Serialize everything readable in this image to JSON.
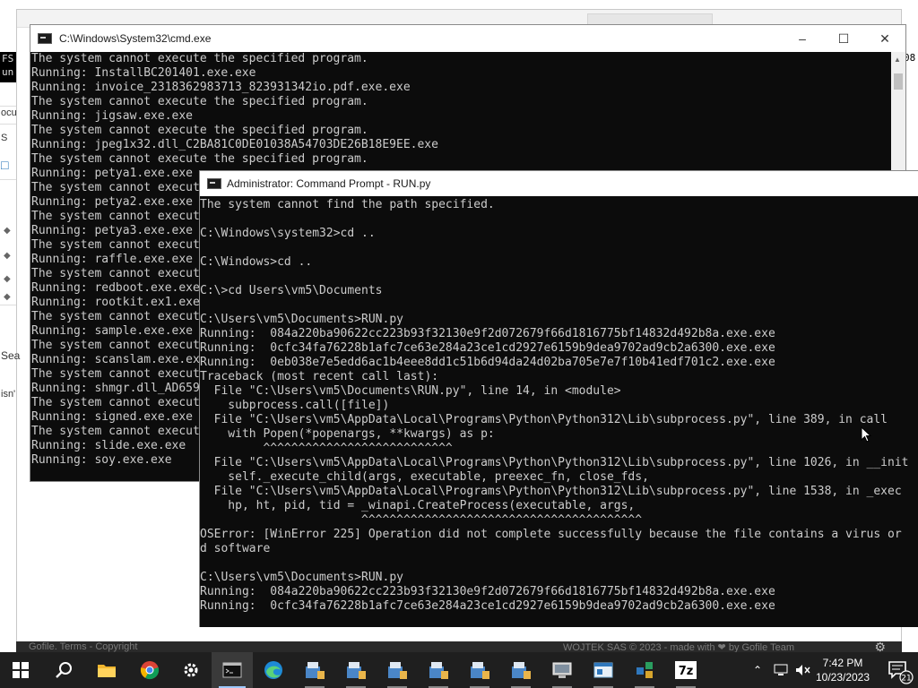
{
  "background": {
    "footer_left": "Gofile. Terms - Copyright",
    "footer_right": "WOJTEK SAS © 2023 - made with ❤ by Gofile Team",
    "left_fragments": [
      "ocu",
      "S",
      "Sea",
      "isn'"
    ],
    "top_left_fragment": [
      "FS",
      "un"
    ],
    "right_fragment": "08"
  },
  "cmd_window": {
    "title": "C:\\Windows\\System32\\cmd.exe",
    "lines": [
      "The system cannot execute the specified program.",
      "Running: InstallBC201401.exe.exe",
      "Running: invoice_2318362983713_823931342io.pdf.exe.exe",
      "The system cannot execute the specified program.",
      "Running: jigsaw.exe.exe",
      "The system cannot execute the specified program.",
      "Running: jpeg1x32.dll_C2BA81C0DE01038A54703DE26B18E9EE.exe",
      "The system cannot execute the specified program.",
      "Running: petya1.exe.exe",
      "The system cannot execut",
      "Running: petya2.exe.exe",
      "The system cannot execut",
      "Running: petya3.exe.exe",
      "The system cannot execut",
      "Running: raffle.exe.exe",
      "The system cannot execut",
      "Running: redboot.exe.exe",
      "Running: rootkit.ex1.exe",
      "The system cannot execut",
      "Running: sample.exe.exe",
      "The system cannot execut",
      "Running: scanslam.exe.ex",
      "The system cannot execut",
      "Running: shmgr.dll_AD659",
      "The system cannot execut",
      "Running: signed.exe.exe",
      "The system cannot execut",
      "Running: slide.exe.exe",
      "Running: soy.exe.exe"
    ]
  },
  "admin_window": {
    "title": "Administrator: Command Prompt - RUN.py",
    "lines": [
      "The system cannot find the path specified.",
      "",
      "C:\\Windows\\system32>cd ..",
      "",
      "C:\\Windows>cd ..",
      "",
      "C:\\>cd Users\\vm5\\Documents",
      "",
      "C:\\Users\\vm5\\Documents>RUN.py",
      "Running:  084a220ba90622cc223b93f32130e9f2d072679f66d1816775bf14832d492b8a.exe.exe",
      "Running:  0cfc34fa76228b1afc7ce63e284a23ce1cd2927e6159b9dea9702ad9cb2a6300.exe.exe",
      "Running:  0eb038e7e5edd6ac1b4eee8dd1c51b6d94da24d02ba705e7e7f10b41edf701c2.exe.exe",
      "Traceback (most recent call last):",
      "  File \"C:\\Users\\vm5\\Documents\\RUN.py\", line 14, in <module>",
      "    subprocess.call([file])",
      "  File \"C:\\Users\\vm5\\AppData\\Local\\Programs\\Python\\Python312\\Lib\\subprocess.py\", line 389, in call",
      "    with Popen(*popenargs, **kwargs) as p:",
      "         ^^^^^^^^^^^^^^^^^^^^^^^^^^^",
      "  File \"C:\\Users\\vm5\\AppData\\Local\\Programs\\Python\\Python312\\Lib\\subprocess.py\", line 1026, in __init",
      "    self._execute_child(args, executable, preexec_fn, close_fds,",
      "  File \"C:\\Users\\vm5\\AppData\\Local\\Programs\\Python\\Python312\\Lib\\subprocess.py\", line 1538, in _exec",
      "    hp, ht, pid, tid = _winapi.CreateProcess(executable, args,",
      "                       ^^^^^^^^^^^^^^^^^^^^^^^^^^^^^^^^^^^^^^^^",
      "OSError: [WinError 225] Operation did not complete successfully because the file contains a virus or",
      "d software",
      "",
      "C:\\Users\\vm5\\Documents>RUN.py",
      "Running:  084a220ba90622cc223b93f32130e9f2d072679f66d1816775bf14832d492b8a.exe.exe",
      "Running:  0cfc34fa76228b1afc7ce63e284a23ce1cd2927e6159b9dea9702ad9cb2a6300.exe.exe"
    ]
  },
  "taskbar": {
    "items": [
      {
        "icon": "windows-start-icon"
      },
      {
        "icon": "search-icon"
      },
      {
        "icon": "file-explorer-icon"
      },
      {
        "icon": "chrome-icon"
      },
      {
        "icon": "settings-icon"
      },
      {
        "icon": "command-prompt-icon",
        "active": true
      },
      {
        "icon": "edge-icon"
      },
      {
        "icon": "installer-icon"
      },
      {
        "icon": "installer-icon"
      },
      {
        "icon": "installer-icon"
      },
      {
        "icon": "installer-icon"
      },
      {
        "icon": "installer-icon"
      },
      {
        "icon": "installer-icon"
      },
      {
        "icon": "network-share-icon"
      },
      {
        "icon": "app-window-icon"
      },
      {
        "icon": "registry-icon"
      },
      {
        "icon": "7zip-icon",
        "label": "7z"
      }
    ],
    "tray": {
      "badge_count": "21"
    },
    "clock": {
      "time": "7:42 PM",
      "date": "10/23/2023"
    }
  },
  "colors": {
    "console_bg": "#0c0c0c",
    "console_text": "#cccccc",
    "taskbar_bg": "#1f1f1f",
    "titlebar_bg": "#ffffff"
  }
}
